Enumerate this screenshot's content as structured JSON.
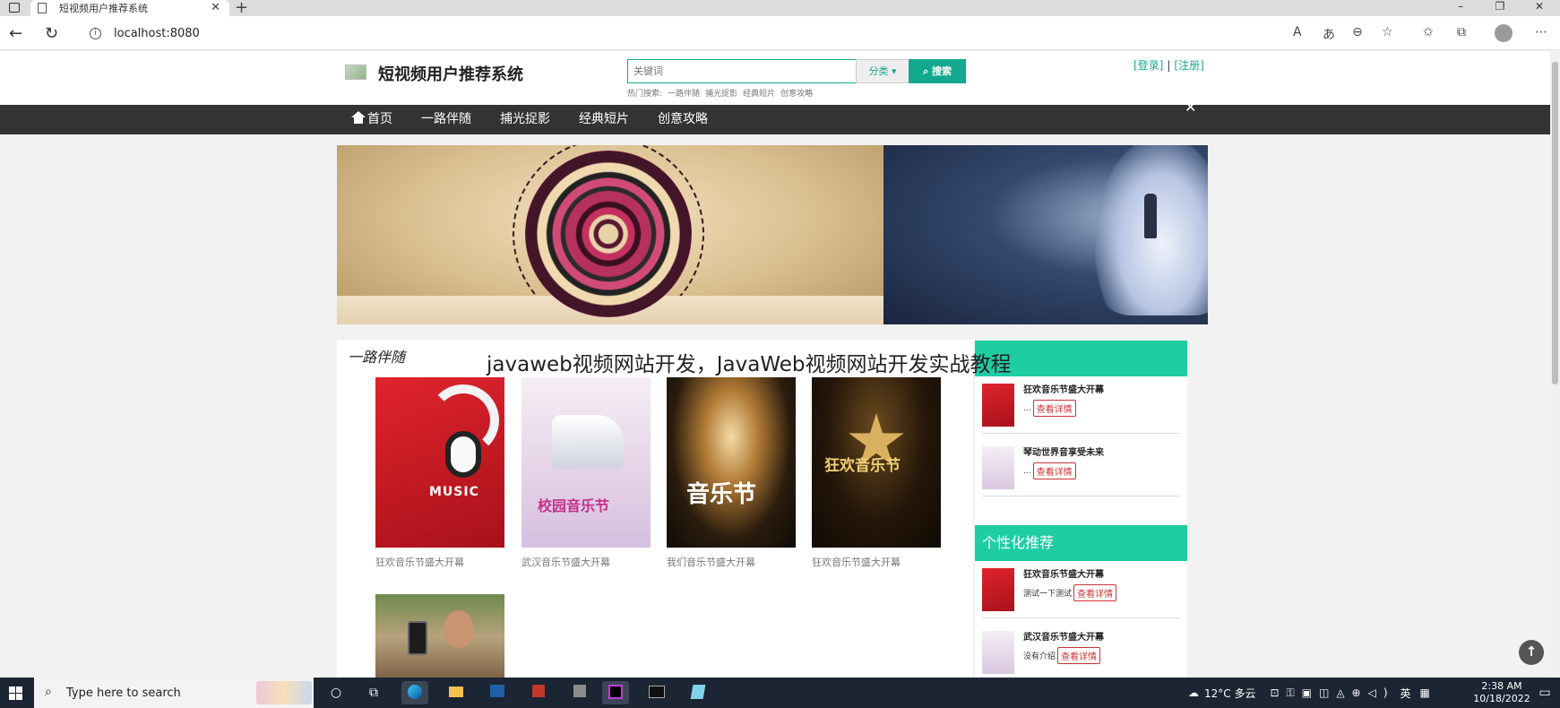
{
  "browser": {
    "tab_title": "短视频用户推荐系统",
    "tab_new": "+",
    "url": "localhost:8080",
    "window_controls": [
      "–",
      "❐",
      "✕"
    ],
    "toolbar_icons": [
      "read-aloud-icon",
      "translate-icon",
      "zoom-icon",
      "favorite-add-icon",
      "favorites-icon",
      "collections-icon",
      "profile-icon",
      "more-icon"
    ]
  },
  "header": {
    "site_title": "短视频用户推荐系统",
    "search_placeholder": "关键词",
    "category_label": "分类 ▾",
    "search_label": "搜索",
    "hot_label": "热门搜索:",
    "hot_terms": [
      "一路伴随",
      "捕光捉影",
      "经典短片",
      "创意攻略"
    ],
    "login": "[登录]",
    "separator": "|",
    "register": "[注册]"
  },
  "nav": {
    "items": [
      "首页",
      "一路伴随",
      "捕光捉影",
      "经典短片",
      "创意攻略"
    ]
  },
  "main": {
    "section_title": "一路伴随",
    "cards": [
      {
        "caption": "狂欢音乐节盛大开幕",
        "poster_text": "MUSIC"
      },
      {
        "caption": "武汉音乐节盛大开幕",
        "poster_text": "校园音乐节"
      },
      {
        "caption": "我们音乐节盛大开幕",
        "poster_text": "音乐节"
      },
      {
        "caption": "狂欢音乐节盛大开幕",
        "poster_text": "狂欢音乐节"
      },
      {
        "caption": "",
        "poster_text": ""
      }
    ]
  },
  "overlay": {
    "title": "javaweb视频网站开发，JavaWeb视频网站开发实战教程"
  },
  "sidebar": {
    "hot": {
      "items": [
        {
          "title": "狂欢音乐节盛大开幕",
          "desc": "...",
          "button": "查看详情"
        },
        {
          "title": "琴动世界音享受未来",
          "desc": "...",
          "button": "查看详情"
        }
      ]
    },
    "personal": {
      "heading": "个性化推荐",
      "items": [
        {
          "title": "狂欢音乐节盛大开幕",
          "desc": "测试一下测试",
          "button": "查看详情"
        },
        {
          "title": "武汉音乐节盛大开幕",
          "desc": "没有介绍",
          "button": "查看详情"
        }
      ]
    }
  },
  "taskbar": {
    "search_placeholder": "Type here to search",
    "weather": "12°C 多云",
    "ime": "英",
    "time": "2:38 AM",
    "date": "10/18/2022"
  }
}
